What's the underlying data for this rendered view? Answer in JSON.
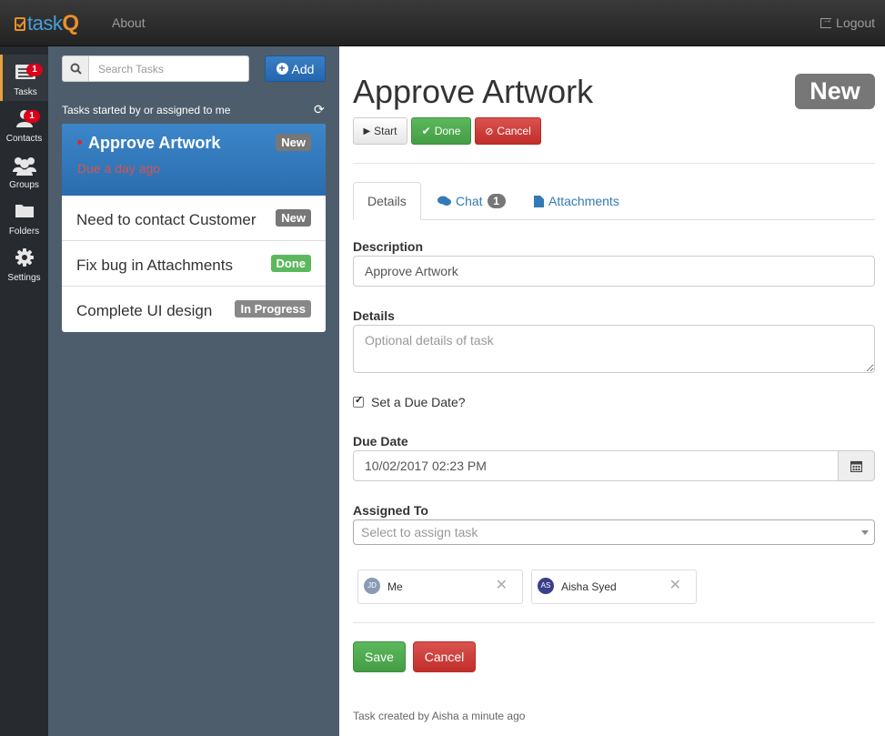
{
  "app": {
    "brand_prefix": "task",
    "brand_suffix": "Q",
    "nav_about": "About",
    "nav_logout": "Logout"
  },
  "rail": {
    "items": [
      {
        "label": "Tasks",
        "badge": "1",
        "icon": "tasks-icon"
      },
      {
        "label": "Contacts",
        "badge": "1",
        "icon": "user-icon"
      },
      {
        "label": "Groups",
        "badge": "",
        "icon": "group-icon"
      },
      {
        "label": "Folders",
        "badge": "",
        "icon": "folder-icon"
      },
      {
        "label": "Settings",
        "badge": "",
        "icon": "gear-icon"
      }
    ]
  },
  "task_panel": {
    "search_placeholder": "Search Tasks",
    "add_label": "Add",
    "caption": "Tasks started by or assigned to me",
    "tasks": [
      {
        "title": "Approve Artwork",
        "status": "New",
        "due": "Due a day ago",
        "selected": true
      },
      {
        "title": "Need to contact Customer",
        "status": "New",
        "due": ""
      },
      {
        "title": "Fix bug in Attachments",
        "status": "Done",
        "due": ""
      },
      {
        "title": "Complete UI design",
        "status": "In Progress",
        "due": ""
      }
    ]
  },
  "detail": {
    "title": "Approve Artwork",
    "status": "New",
    "actions": {
      "start": "Start",
      "done": "Done",
      "cancel": "Cancel"
    },
    "tabs": [
      {
        "label": "Details"
      },
      {
        "label": "Chat",
        "badge": "1"
      },
      {
        "label": "Attachments"
      }
    ],
    "form": {
      "description_label": "Description",
      "description_value": "Approve Artwork",
      "details_label": "Details",
      "details_placeholder": "Optional details of task",
      "due_checkbox_label": "Set a Due Date?",
      "due_checked": true,
      "due_date_label": "Due Date",
      "due_date_value": "10/02/2017 02:23 PM",
      "assigned_label": "Assigned To",
      "assigned_placeholder": "Select to assign task",
      "assignees": [
        {
          "initials": "JD",
          "name": "Me",
          "color": "#8a9bb5"
        },
        {
          "initials": "AS",
          "name": "Aisha Syed",
          "color": "#3a3f8c"
        }
      ],
      "save_label": "Save",
      "cancel_label": "Cancel"
    },
    "footer": "Task created by Aisha a minute ago"
  },
  "colors": {
    "accent": "#2a6dae",
    "success": "#5cb85c",
    "danger": "#d9534f",
    "panel": "#4e5d6c",
    "rail": "#272b30"
  }
}
